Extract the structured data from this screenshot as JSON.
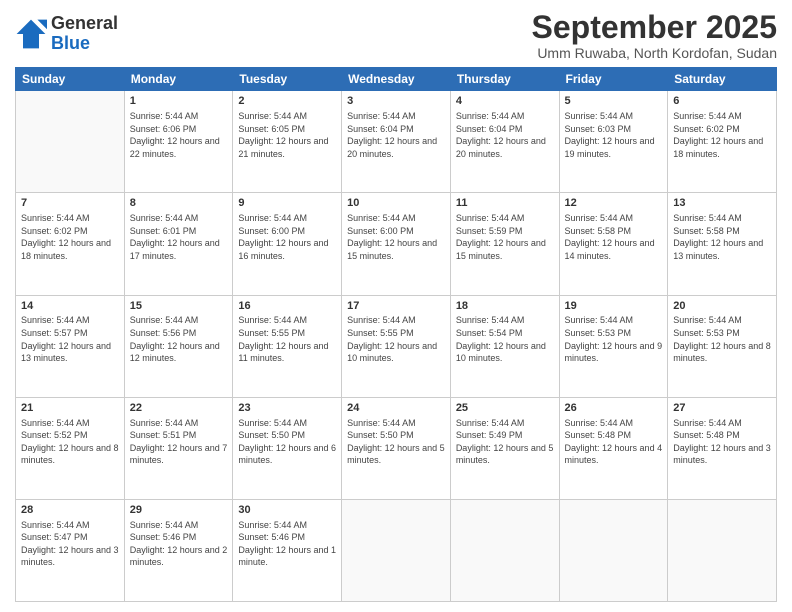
{
  "header": {
    "logo_line1": "General",
    "logo_line2": "Blue",
    "month": "September 2025",
    "location": "Umm Ruwaba, North Kordofan, Sudan"
  },
  "weekdays": [
    "Sunday",
    "Monday",
    "Tuesday",
    "Wednesday",
    "Thursday",
    "Friday",
    "Saturday"
  ],
  "weeks": [
    [
      {
        "day": "",
        "sunrise": "",
        "sunset": "",
        "daylight": ""
      },
      {
        "day": "1",
        "sunrise": "Sunrise: 5:44 AM",
        "sunset": "Sunset: 6:06 PM",
        "daylight": "Daylight: 12 hours and 22 minutes."
      },
      {
        "day": "2",
        "sunrise": "Sunrise: 5:44 AM",
        "sunset": "Sunset: 6:05 PM",
        "daylight": "Daylight: 12 hours and 21 minutes."
      },
      {
        "day": "3",
        "sunrise": "Sunrise: 5:44 AM",
        "sunset": "Sunset: 6:04 PM",
        "daylight": "Daylight: 12 hours and 20 minutes."
      },
      {
        "day": "4",
        "sunrise": "Sunrise: 5:44 AM",
        "sunset": "Sunset: 6:04 PM",
        "daylight": "Daylight: 12 hours and 20 minutes."
      },
      {
        "day": "5",
        "sunrise": "Sunrise: 5:44 AM",
        "sunset": "Sunset: 6:03 PM",
        "daylight": "Daylight: 12 hours and 19 minutes."
      },
      {
        "day": "6",
        "sunrise": "Sunrise: 5:44 AM",
        "sunset": "Sunset: 6:02 PM",
        "daylight": "Daylight: 12 hours and 18 minutes."
      }
    ],
    [
      {
        "day": "7",
        "sunrise": "Sunrise: 5:44 AM",
        "sunset": "Sunset: 6:02 PM",
        "daylight": "Daylight: 12 hours and 18 minutes."
      },
      {
        "day": "8",
        "sunrise": "Sunrise: 5:44 AM",
        "sunset": "Sunset: 6:01 PM",
        "daylight": "Daylight: 12 hours and 17 minutes."
      },
      {
        "day": "9",
        "sunrise": "Sunrise: 5:44 AM",
        "sunset": "Sunset: 6:00 PM",
        "daylight": "Daylight: 12 hours and 16 minutes."
      },
      {
        "day": "10",
        "sunrise": "Sunrise: 5:44 AM",
        "sunset": "Sunset: 6:00 PM",
        "daylight": "Daylight: 12 hours and 15 minutes."
      },
      {
        "day": "11",
        "sunrise": "Sunrise: 5:44 AM",
        "sunset": "Sunset: 5:59 PM",
        "daylight": "Daylight: 12 hours and 15 minutes."
      },
      {
        "day": "12",
        "sunrise": "Sunrise: 5:44 AM",
        "sunset": "Sunset: 5:58 PM",
        "daylight": "Daylight: 12 hours and 14 minutes."
      },
      {
        "day": "13",
        "sunrise": "Sunrise: 5:44 AM",
        "sunset": "Sunset: 5:58 PM",
        "daylight": "Daylight: 12 hours and 13 minutes."
      }
    ],
    [
      {
        "day": "14",
        "sunrise": "Sunrise: 5:44 AM",
        "sunset": "Sunset: 5:57 PM",
        "daylight": "Daylight: 12 hours and 13 minutes."
      },
      {
        "day": "15",
        "sunrise": "Sunrise: 5:44 AM",
        "sunset": "Sunset: 5:56 PM",
        "daylight": "Daylight: 12 hours and 12 minutes."
      },
      {
        "day": "16",
        "sunrise": "Sunrise: 5:44 AM",
        "sunset": "Sunset: 5:55 PM",
        "daylight": "Daylight: 12 hours and 11 minutes."
      },
      {
        "day": "17",
        "sunrise": "Sunrise: 5:44 AM",
        "sunset": "Sunset: 5:55 PM",
        "daylight": "Daylight: 12 hours and 10 minutes."
      },
      {
        "day": "18",
        "sunrise": "Sunrise: 5:44 AM",
        "sunset": "Sunset: 5:54 PM",
        "daylight": "Daylight: 12 hours and 10 minutes."
      },
      {
        "day": "19",
        "sunrise": "Sunrise: 5:44 AM",
        "sunset": "Sunset: 5:53 PM",
        "daylight": "Daylight: 12 hours and 9 minutes."
      },
      {
        "day": "20",
        "sunrise": "Sunrise: 5:44 AM",
        "sunset": "Sunset: 5:53 PM",
        "daylight": "Daylight: 12 hours and 8 minutes."
      }
    ],
    [
      {
        "day": "21",
        "sunrise": "Sunrise: 5:44 AM",
        "sunset": "Sunset: 5:52 PM",
        "daylight": "Daylight: 12 hours and 8 minutes."
      },
      {
        "day": "22",
        "sunrise": "Sunrise: 5:44 AM",
        "sunset": "Sunset: 5:51 PM",
        "daylight": "Daylight: 12 hours and 7 minutes."
      },
      {
        "day": "23",
        "sunrise": "Sunrise: 5:44 AM",
        "sunset": "Sunset: 5:50 PM",
        "daylight": "Daylight: 12 hours and 6 minutes."
      },
      {
        "day": "24",
        "sunrise": "Sunrise: 5:44 AM",
        "sunset": "Sunset: 5:50 PM",
        "daylight": "Daylight: 12 hours and 5 minutes."
      },
      {
        "day": "25",
        "sunrise": "Sunrise: 5:44 AM",
        "sunset": "Sunset: 5:49 PM",
        "daylight": "Daylight: 12 hours and 5 minutes."
      },
      {
        "day": "26",
        "sunrise": "Sunrise: 5:44 AM",
        "sunset": "Sunset: 5:48 PM",
        "daylight": "Daylight: 12 hours and 4 minutes."
      },
      {
        "day": "27",
        "sunrise": "Sunrise: 5:44 AM",
        "sunset": "Sunset: 5:48 PM",
        "daylight": "Daylight: 12 hours and 3 minutes."
      }
    ],
    [
      {
        "day": "28",
        "sunrise": "Sunrise: 5:44 AM",
        "sunset": "Sunset: 5:47 PM",
        "daylight": "Daylight: 12 hours and 3 minutes."
      },
      {
        "day": "29",
        "sunrise": "Sunrise: 5:44 AM",
        "sunset": "Sunset: 5:46 PM",
        "daylight": "Daylight: 12 hours and 2 minutes."
      },
      {
        "day": "30",
        "sunrise": "Sunrise: 5:44 AM",
        "sunset": "Sunset: 5:46 PM",
        "daylight": "Daylight: 12 hours and 1 minute."
      },
      {
        "day": "",
        "sunrise": "",
        "sunset": "",
        "daylight": ""
      },
      {
        "day": "",
        "sunrise": "",
        "sunset": "",
        "daylight": ""
      },
      {
        "day": "",
        "sunrise": "",
        "sunset": "",
        "daylight": ""
      },
      {
        "day": "",
        "sunrise": "",
        "sunset": "",
        "daylight": ""
      }
    ]
  ]
}
